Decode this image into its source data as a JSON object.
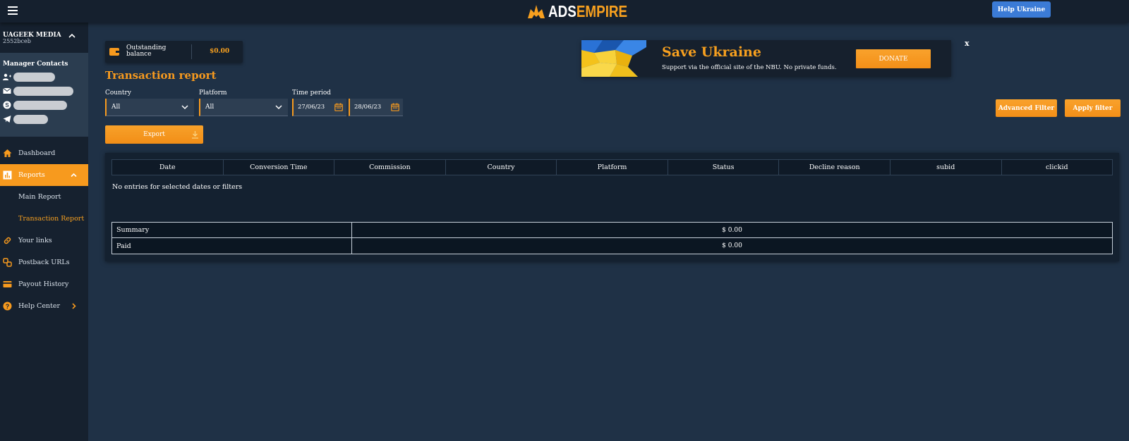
{
  "header": {
    "logo_ads": "ADS",
    "logo_empire": "EMPIRE",
    "help_button": "Help Ukraine"
  },
  "sidebar": {
    "account_name": "UAGEEK MEDIA",
    "account_id": "2552bceb",
    "contacts_title": "Manager Contacts",
    "nav": {
      "dashboard": "Dashboard",
      "reports": "Reports",
      "main_report": "Main Report",
      "transaction_report": "Transaction Report",
      "your_links": "Your links",
      "postback_urls": "Postback URLs",
      "payout_history": "Payout History",
      "help_center": "Help Center"
    }
  },
  "balance": {
    "label": "Outstanding balance",
    "amount": "$0.00"
  },
  "page_title": "Transaction report",
  "filters": {
    "country_label": "Country",
    "country_value": "All",
    "platform_label": "Platform",
    "platform_value": "All",
    "period_label": "Time period",
    "date_from": "27/06/23",
    "date_to": "28/06/23",
    "export": "Export",
    "advanced_filter": "Advanced Filter",
    "apply_filter": "Apply filter"
  },
  "banner": {
    "title": "Save Ukraine",
    "text": "Support via the official site of the NBU. No private funds.",
    "donate": "DONATE",
    "close": "x"
  },
  "table": {
    "columns": [
      "Date",
      "Conversion Time",
      "Commission",
      "Country",
      "Platform",
      "Status",
      "Decline reason",
      "subid",
      "clickid"
    ],
    "empty_message": "No entries for selected dates or filters",
    "summary_label": "Summary",
    "summary_value": "$ 0.00",
    "paid_label": "Paid",
    "paid_value": "$ 0.00"
  },
  "colors": {
    "accent": "#f79a1e",
    "background": "#1f3146",
    "sidebar": "#16212f",
    "help_button": "#3b7bd6"
  }
}
